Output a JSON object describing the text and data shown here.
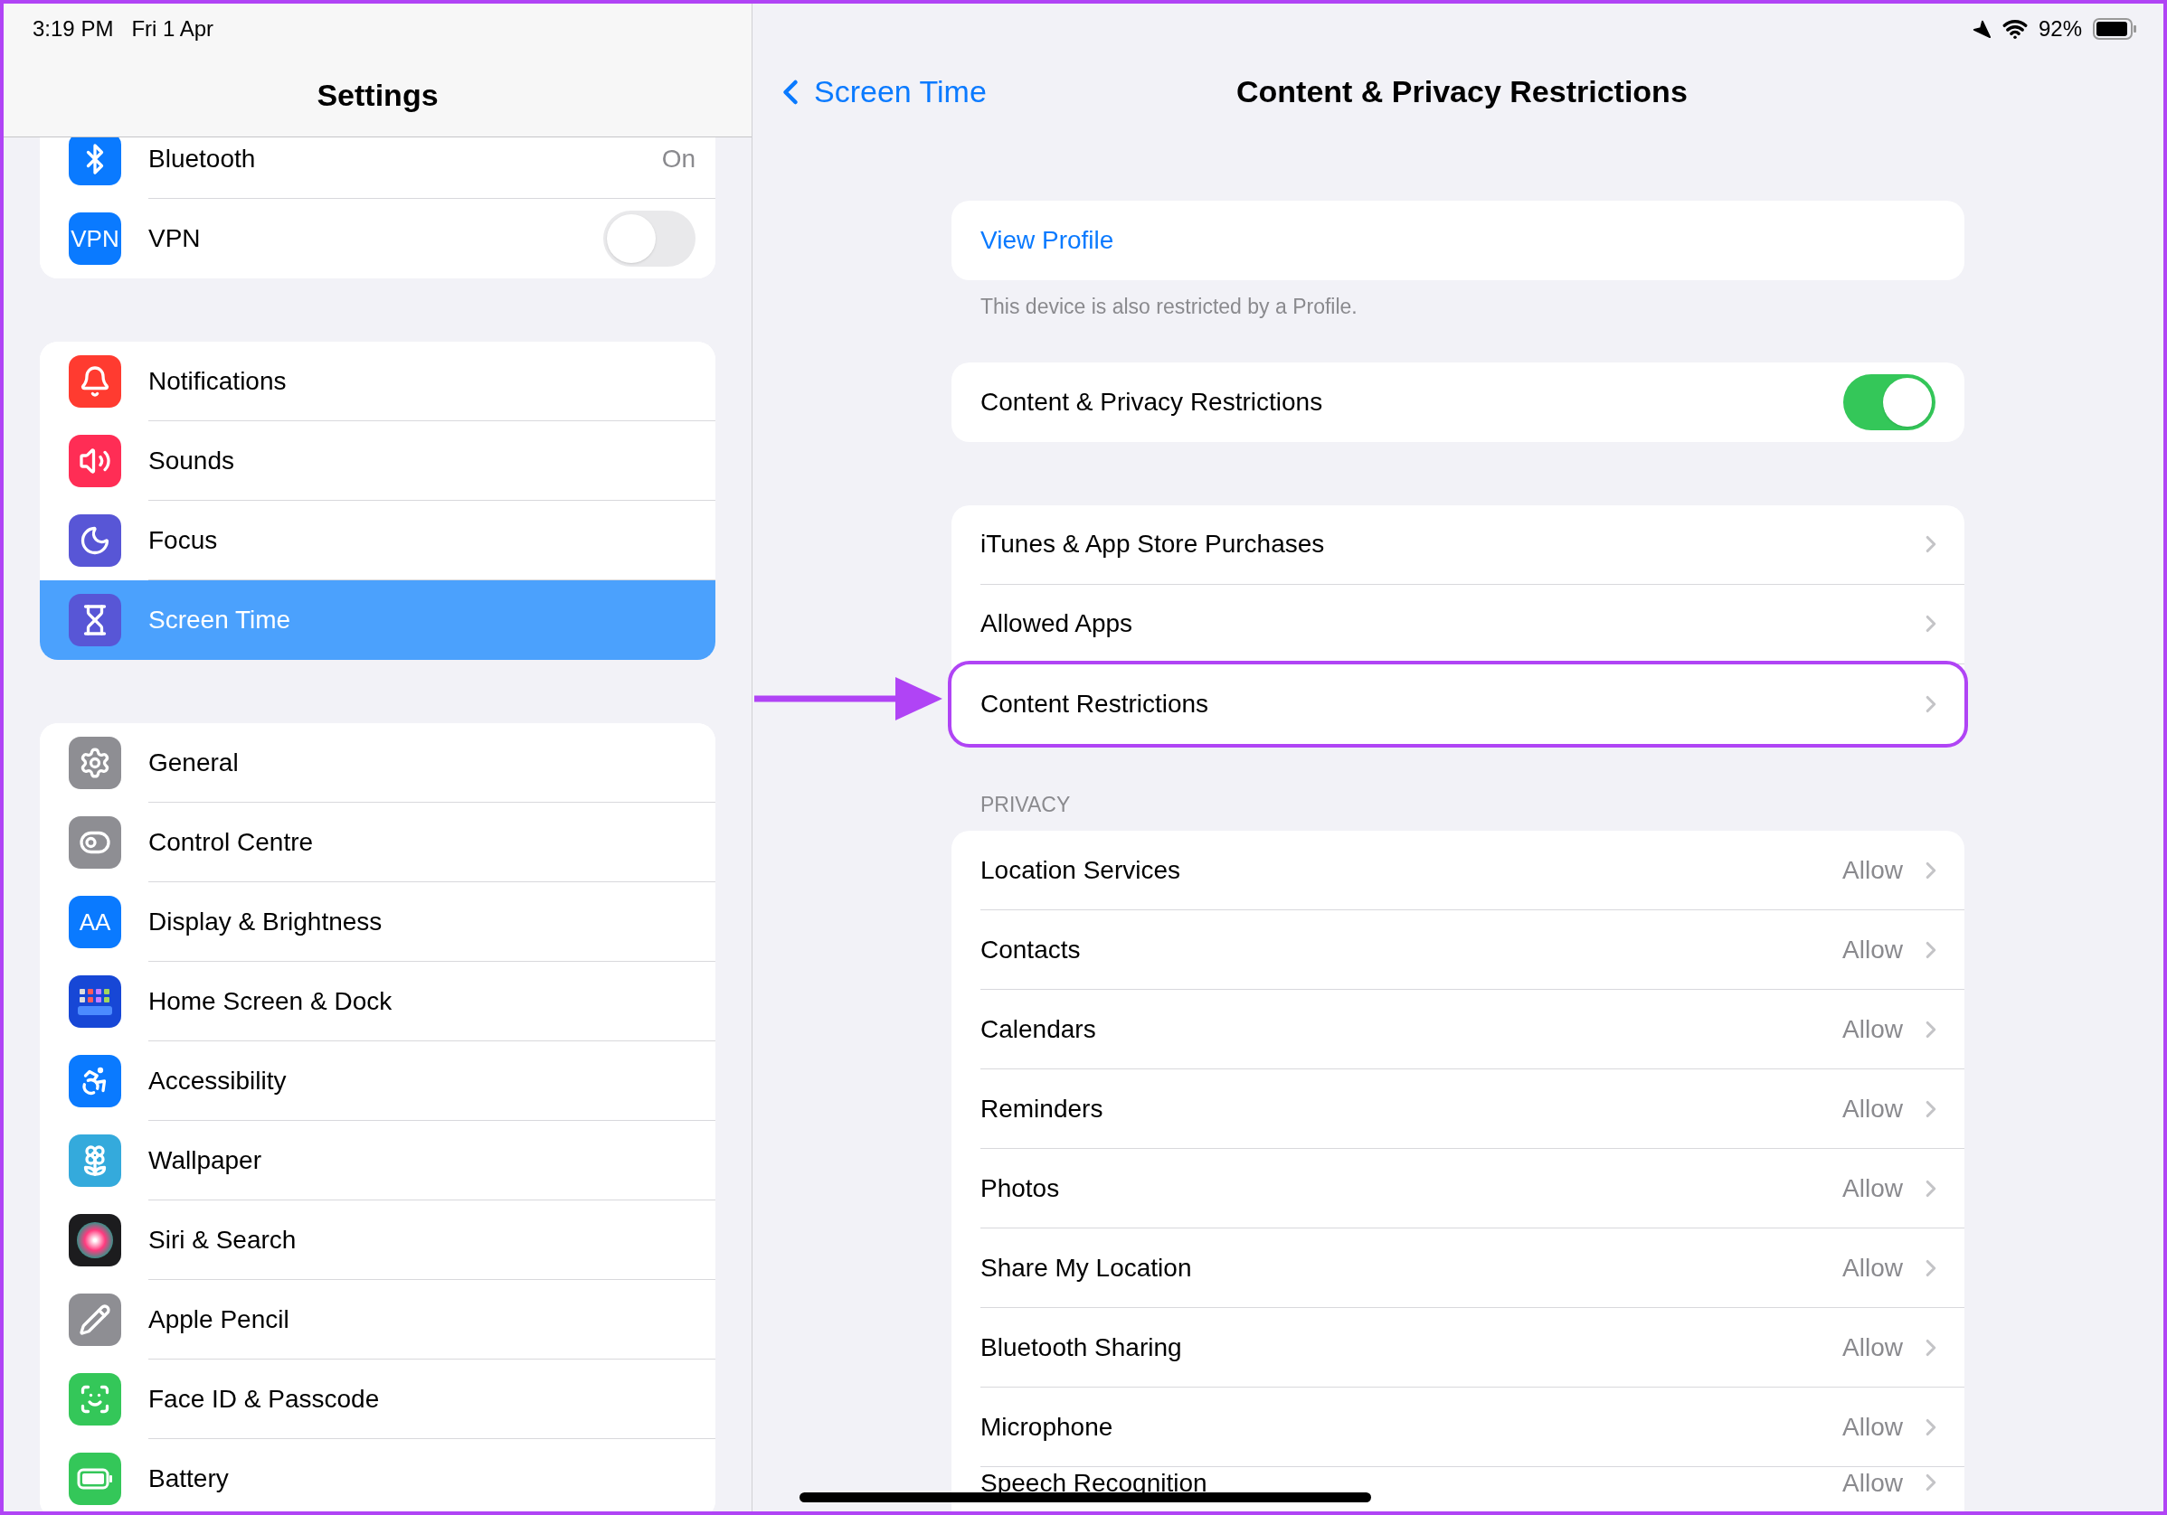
{
  "status_bar": {
    "time": "3:19 PM",
    "date": "Fri 1 Apr",
    "battery": "92%"
  },
  "sidebar": {
    "title": "Settings",
    "groups": [
      {
        "items": [
          {
            "label": "Bluetooth",
            "kind": "value",
            "value": "On",
            "selected": false
          },
          {
            "label": "VPN",
            "kind": "toggle",
            "icon_text": "VPN",
            "on": false,
            "selected": false
          }
        ]
      },
      {
        "items": [
          {
            "label": "Notifications",
            "kind": "link",
            "selected": false
          },
          {
            "label": "Sounds",
            "kind": "link",
            "selected": false
          },
          {
            "label": "Focus",
            "kind": "link",
            "selected": false
          },
          {
            "label": "Screen Time",
            "kind": "link",
            "selected": true
          }
        ]
      },
      {
        "items": [
          {
            "label": "General",
            "kind": "link",
            "selected": false
          },
          {
            "label": "Control Centre",
            "kind": "link",
            "selected": false
          },
          {
            "label": "Display & Brightness",
            "kind": "link",
            "icon_text": "AA",
            "selected": false
          },
          {
            "label": "Home Screen & Dock",
            "kind": "link",
            "selected": false
          },
          {
            "label": "Accessibility",
            "kind": "link",
            "selected": false
          },
          {
            "label": "Wallpaper",
            "kind": "link",
            "selected": false
          },
          {
            "label": "Siri & Search",
            "kind": "link",
            "selected": false
          },
          {
            "label": "Apple Pencil",
            "kind": "link",
            "selected": false
          },
          {
            "label": "Face ID & Passcode",
            "kind": "link",
            "selected": false
          },
          {
            "label": "Battery",
            "kind": "link",
            "selected": false
          }
        ]
      }
    ]
  },
  "detail": {
    "back_label": "Screen Time",
    "title": "Content & Privacy Restrictions",
    "profile": {
      "link": "View Profile",
      "footnote": "This device is also restricted by a Profile."
    },
    "main_toggle": {
      "label": "Content & Privacy Restrictions",
      "on": true
    },
    "restrictions": [
      {
        "label": "iTunes & App Store Purchases",
        "highlighted": false
      },
      {
        "label": "Allowed Apps",
        "highlighted": false
      },
      {
        "label": "Content Restrictions",
        "highlighted": true
      }
    ],
    "privacy": {
      "header": "PRIVACY",
      "rows": [
        {
          "label": "Location Services",
          "value": "Allow"
        },
        {
          "label": "Contacts",
          "value": "Allow"
        },
        {
          "label": "Calendars",
          "value": "Allow"
        },
        {
          "label": "Reminders",
          "value": "Allow"
        },
        {
          "label": "Photos",
          "value": "Allow"
        },
        {
          "label": "Share My Location",
          "value": "Allow"
        },
        {
          "label": "Bluetooth Sharing",
          "value": "Allow"
        },
        {
          "label": "Microphone",
          "value": "Allow"
        },
        {
          "label": "Speech Recognition",
          "value": "Allow"
        }
      ]
    }
  }
}
